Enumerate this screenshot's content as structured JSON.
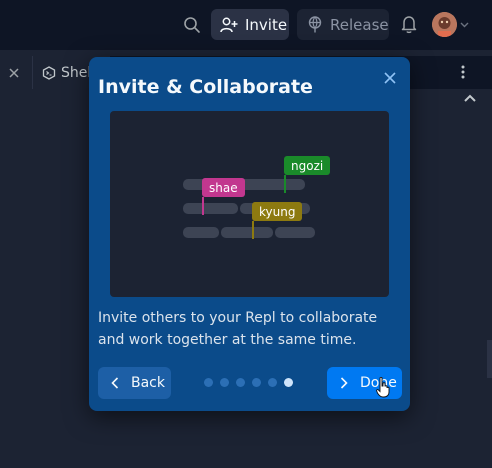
{
  "header": {
    "invite_label": "Invite",
    "release_label": "Release",
    "icons": [
      "search-icon",
      "add-user-icon",
      "release-icon",
      "bell-icon",
      "avatar",
      "chevron-down-icon"
    ]
  },
  "tabs": {
    "shell_label": "Shell"
  },
  "popup": {
    "title": "Invite & Collaborate",
    "description": "Invite others to your Repl to collaborate and work together at the same time.",
    "illustration": {
      "collaborators": [
        {
          "name": "shae",
          "color": "#c2378f"
        },
        {
          "name": "ngozi",
          "color": "#1a8a2a"
        },
        {
          "name": "kyung",
          "color": "#8d7a10"
        }
      ]
    },
    "back_label": "Back",
    "done_label": "Done",
    "steps_total": 6,
    "current_step": 6
  },
  "colors": {
    "app_bg": "#1c2333",
    "header_bg": "#0e1525",
    "popup_bg": "#0b4b8a",
    "primary_button": "#0079f2"
  }
}
